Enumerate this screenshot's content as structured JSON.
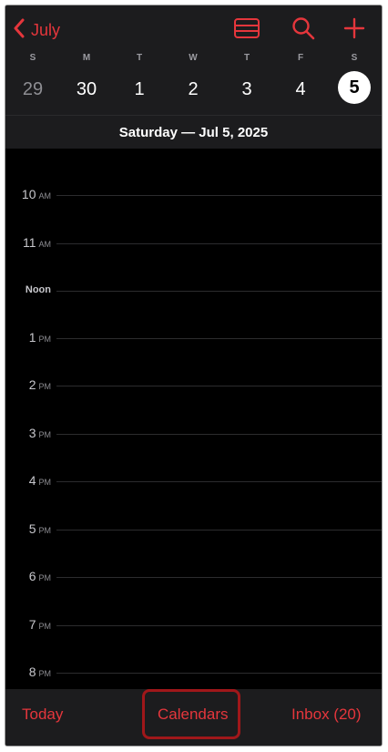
{
  "header": {
    "back_label": "July",
    "icons": [
      "list-view-icon",
      "search-icon",
      "plus-icon"
    ],
    "weekdays": [
      "S",
      "M",
      "T",
      "W",
      "T",
      "F",
      "S"
    ],
    "days": [
      "29",
      "30",
      "1",
      "2",
      "3",
      "4",
      "5"
    ]
  },
  "date_title": "Saturday — Jul 5, 2025",
  "timeline": {
    "hours": [
      {
        "n": "10",
        "ap": "AM"
      },
      {
        "n": "11",
        "ap": "AM"
      },
      {
        "noon": "Noon"
      },
      {
        "n": "1",
        "ap": "PM"
      },
      {
        "n": "2",
        "ap": "PM"
      },
      {
        "n": "3",
        "ap": "PM"
      },
      {
        "n": "4",
        "ap": "PM"
      },
      {
        "n": "5",
        "ap": "PM"
      },
      {
        "n": "6",
        "ap": "PM"
      },
      {
        "n": "7",
        "ap": "PM"
      },
      {
        "n": "8",
        "ap": "PM"
      }
    ]
  },
  "tabbar": {
    "today": "Today",
    "calendars": "Calendars",
    "inbox": "Inbox (20)"
  },
  "colors": {
    "accent": "#e5363c",
    "highlight": "#a0171a",
    "background": "#000000"
  }
}
